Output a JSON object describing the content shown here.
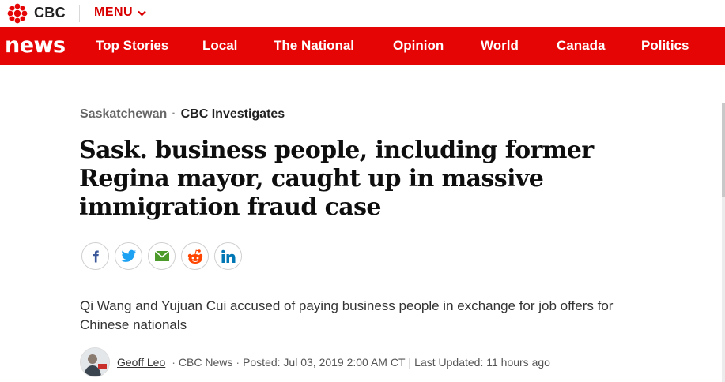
{
  "topbar": {
    "brand": "CBC",
    "menu_label": "MENU"
  },
  "nav": {
    "wordmark": "news",
    "items": [
      "Top Stories",
      "Local",
      "The National",
      "Opinion",
      "World",
      "Canada",
      "Politics"
    ]
  },
  "article": {
    "section": "Saskatchewan",
    "separator": "·",
    "subsection": "CBC Investigates",
    "headline": "Sask. business people, including former Regina mayor, caught up in massive immigration fraud case",
    "deck": "Qi Wang and Yujuan Cui accused of paying business people in exchange for job offers for Chinese nationals",
    "byline": {
      "author": "Geoff Leo",
      "outlet": "CBC News",
      "posted": "Posted: Jul 03, 2019 2:00 AM CT",
      "divider": "|",
      "updated": "Last Updated: 11 hours ago"
    }
  },
  "share": [
    {
      "icon": "facebook-icon",
      "color": "#3b5998"
    },
    {
      "icon": "twitter-icon",
      "color": "#1da1f2"
    },
    {
      "icon": "email-icon",
      "color": "#4c9a2a"
    },
    {
      "icon": "reddit-icon",
      "color": "#ff4500"
    },
    {
      "icon": "linkedin-icon",
      "color": "#0077b5"
    }
  ],
  "colors": {
    "brand_red": "#e60505",
    "menu_red": "#d80000"
  }
}
